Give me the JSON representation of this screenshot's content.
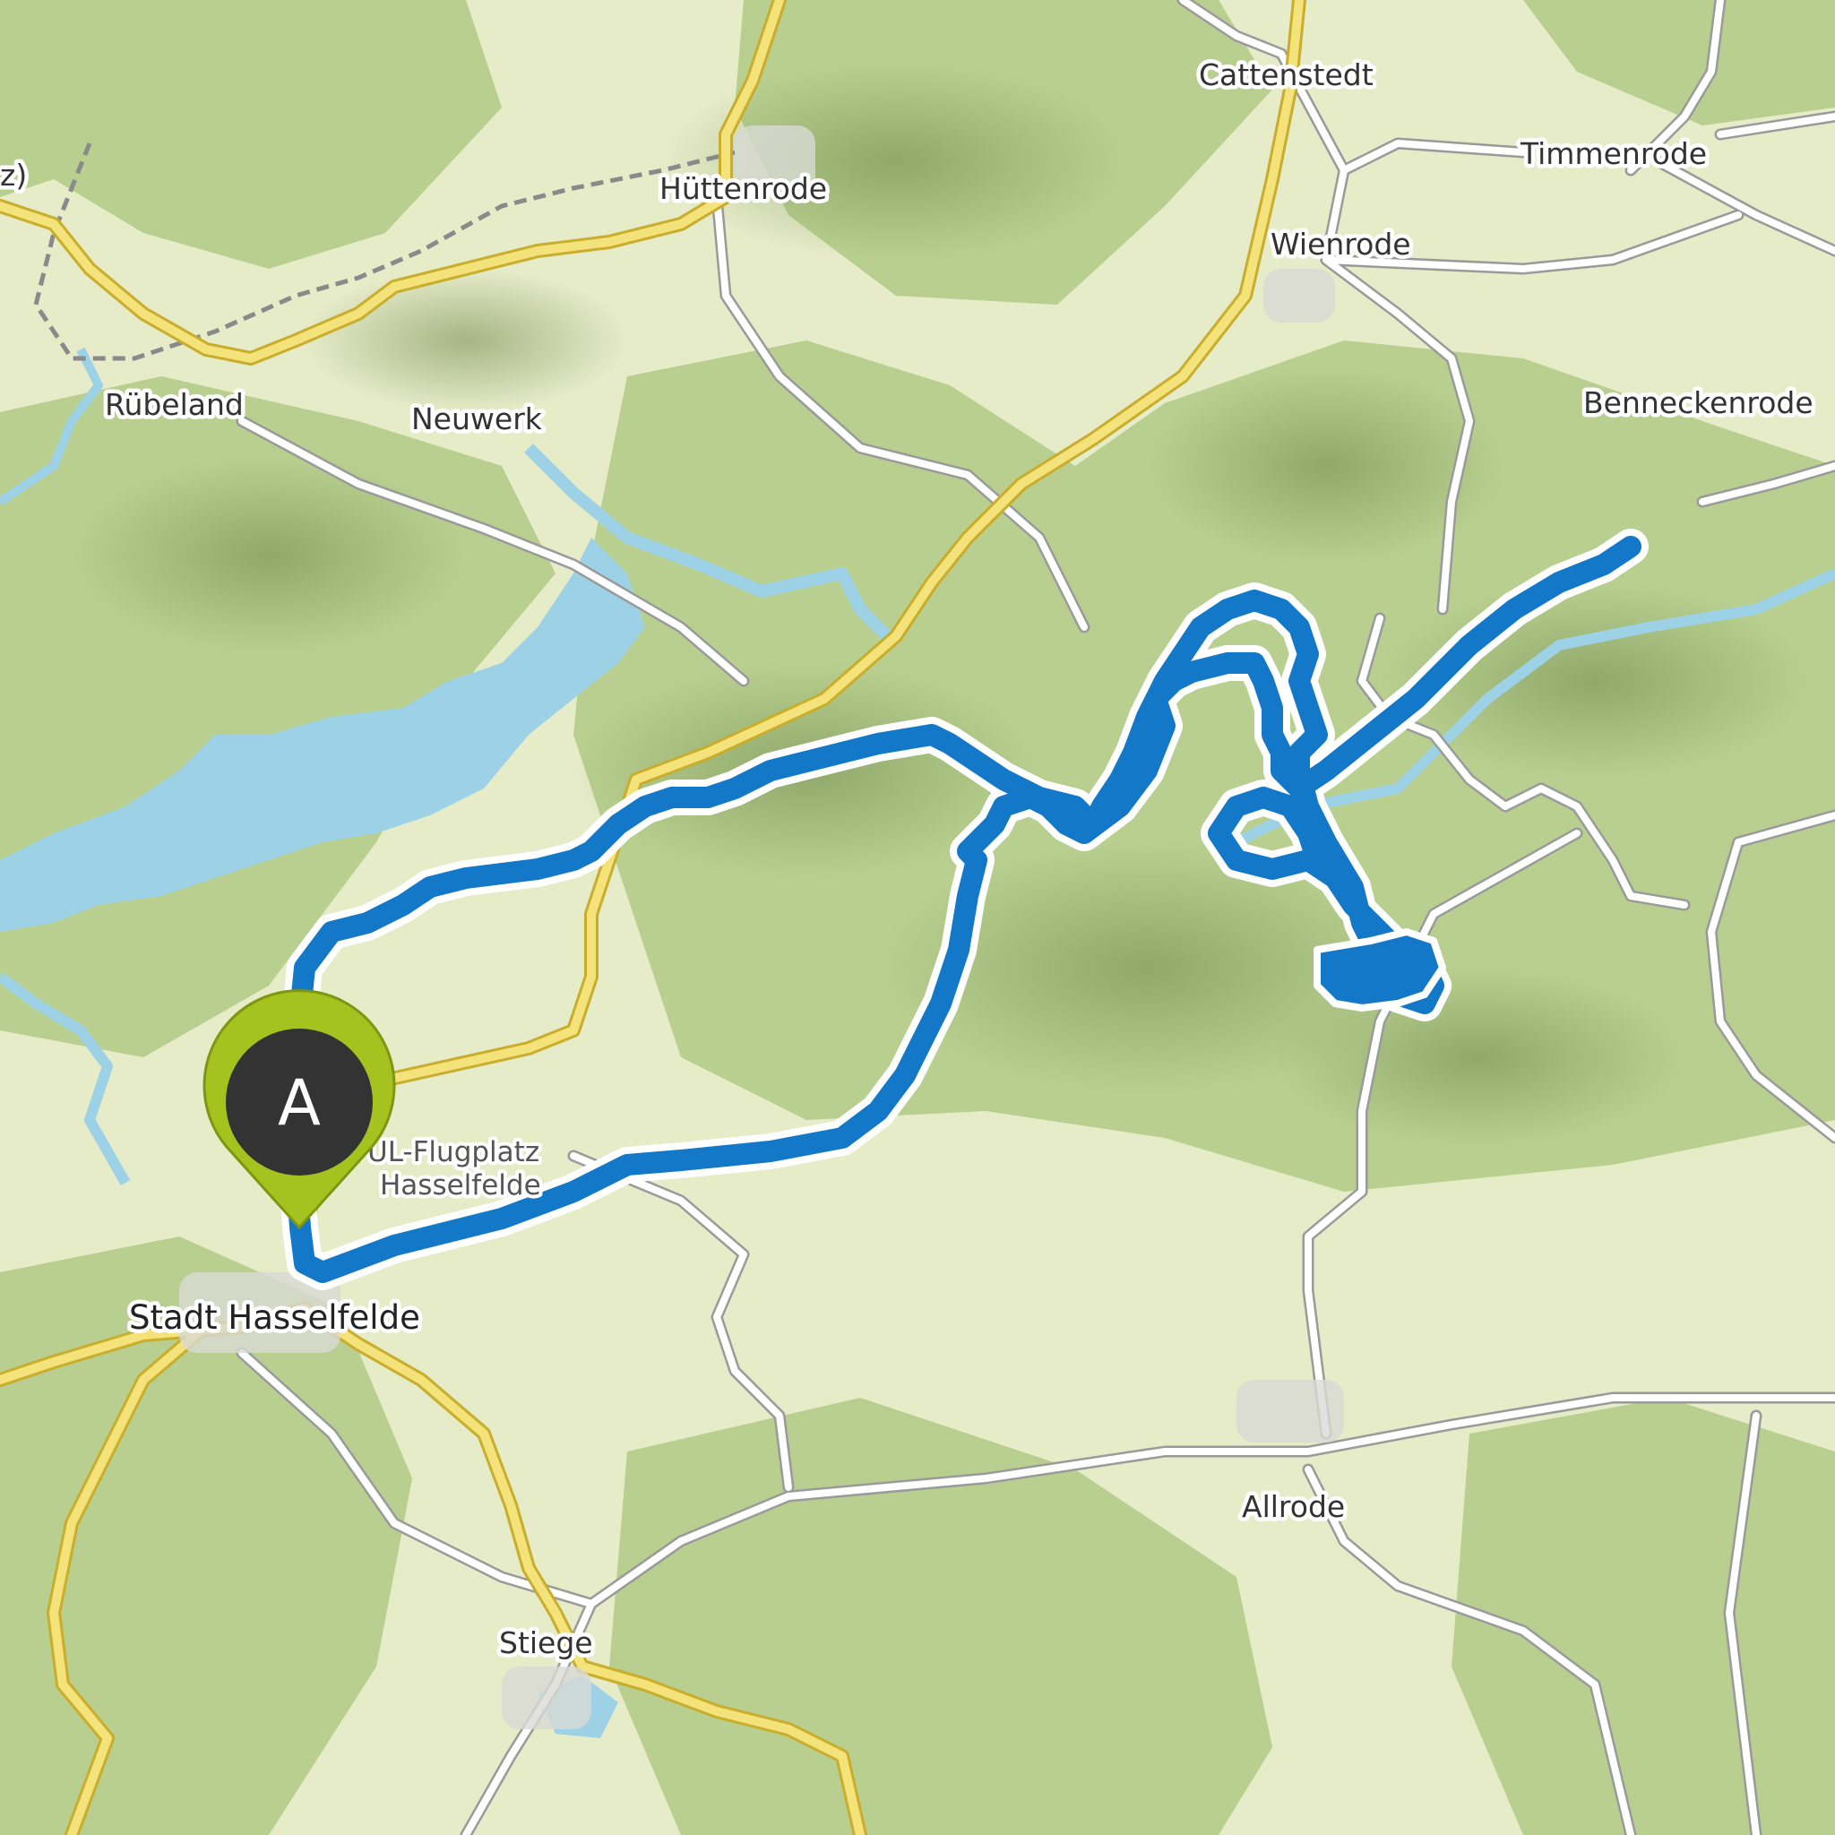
{
  "map": {
    "places": {
      "cattenstedt": "Cattenstedt",
      "timmenrode": "Timmenrode",
      "huettenrode": "Hüttenrode",
      "wienrode": "Wienrode",
      "ruebeland": "Rübeland",
      "neuwerk": "Neuwerk",
      "benneckenrode": "Benneckenrode",
      "hasselfelde": "Stadt Hasselfelde",
      "allrode": "Allrode",
      "stiege": "Stiege",
      "edge_fragment": "z)"
    },
    "poi": {
      "airfield_line1": "UL-Flugplatz",
      "airfield_line2": "Hasselfelde"
    },
    "start_marker": {
      "letter": "A",
      "pin_color": "#a6c21e",
      "badge_color": "#333333"
    },
    "colors": {
      "route": "#1478c8",
      "route_casing": "#ffffff",
      "water": "#9dd1e6",
      "forest": "#b8cf8f",
      "meadow": "#e6ebc8",
      "main_road": "#f4e27a"
    }
  }
}
